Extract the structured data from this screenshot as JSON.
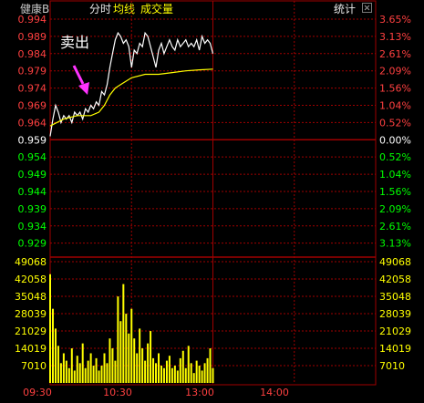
{
  "header": {
    "stock_name": "健康B",
    "tab_fenshi": "分时",
    "tab_junxian": "均线",
    "tab_volume": "成交量",
    "stats_label": "统计"
  },
  "annotation": {
    "text": "卖出",
    "arrow_color": "#ff33ff"
  },
  "colors": {
    "up": "#ff4040",
    "down": "#00ff00",
    "neutral": "#ffffff",
    "grid": "#a00000",
    "price_line": "#ffffff",
    "avg_line": "#ffff00",
    "volume_bar": "#ffff00"
  },
  "chart_data": {
    "type": "line",
    "title": "",
    "price_axis": {
      "ticks": [
        "0.994",
        "0.989",
        "0.984",
        "0.979",
        "0.974",
        "0.969",
        "0.964",
        "0.959",
        "0.954",
        "0.949",
        "0.944",
        "0.939",
        "0.934",
        "0.929"
      ],
      "ylim": [
        0.926,
        0.994
      ],
      "prev_close": 0.959
    },
    "percent_axis": {
      "ticks": [
        "3.65%",
        "3.13%",
        "2.61%",
        "2.09%",
        "1.56%",
        "1.04%",
        "0.52%",
        "0.00%",
        "0.52%",
        "1.04%",
        "1.56%",
        "2.09%",
        "2.61%",
        "3.13%"
      ]
    },
    "volume_axis": {
      "ticks": [
        "49068",
        "42058",
        "35048",
        "28039",
        "21029",
        "14019",
        "7010"
      ],
      "ylim": [
        0,
        49068
      ]
    },
    "x_axis": {
      "ticks": [
        "09:30",
        "10:30",
        "13:00",
        "14:00"
      ],
      "minutes_total": 240
    },
    "series": [
      {
        "name": "分时",
        "x": [
          0,
          2,
          4,
          6,
          8,
          10,
          12,
          14,
          16,
          18,
          20,
          22,
          24,
          26,
          28,
          30,
          32,
          34,
          36,
          38,
          40,
          42,
          44,
          46,
          48,
          50,
          52,
          54,
          56,
          58,
          60,
          62,
          64,
          66,
          68,
          70,
          72,
          74,
          76,
          78,
          80,
          82,
          84,
          86,
          88,
          90,
          92,
          94,
          96,
          98,
          100,
          102,
          104,
          106,
          108,
          110,
          112,
          114,
          116,
          118,
          120
        ],
        "values": [
          0.96,
          0.965,
          0.969,
          0.967,
          0.964,
          0.966,
          0.965,
          0.966,
          0.964,
          0.967,
          0.966,
          0.967,
          0.965,
          0.968,
          0.967,
          0.969,
          0.968,
          0.97,
          0.969,
          0.973,
          0.972,
          0.975,
          0.98,
          0.984,
          0.988,
          0.99,
          0.989,
          0.987,
          0.988,
          0.986,
          0.98,
          0.985,
          0.984,
          0.987,
          0.986,
          0.99,
          0.989,
          0.986,
          0.983,
          0.98,
          0.985,
          0.987,
          0.984,
          0.986,
          0.988,
          0.986,
          0.985,
          0.988,
          0.986,
          0.987,
          0.988,
          0.986,
          0.987,
          0.986,
          0.988,
          0.985,
          0.989,
          0.987,
          0.988,
          0.987,
          0.984
        ]
      },
      {
        "name": "均线",
        "x": [
          0,
          10,
          20,
          30,
          36,
          40,
          44,
          48,
          52,
          56,
          60,
          70,
          80,
          90,
          100,
          110,
          120
        ],
        "values": [
          0.963,
          0.965,
          0.966,
          0.966,
          0.967,
          0.969,
          0.972,
          0.974,
          0.975,
          0.976,
          0.977,
          0.978,
          0.978,
          0.9785,
          0.979,
          0.9793,
          0.9795
        ]
      }
    ],
    "volume": {
      "x": [
        0,
        2,
        4,
        6,
        8,
        10,
        12,
        14,
        16,
        18,
        20,
        22,
        24,
        26,
        28,
        30,
        32,
        34,
        36,
        38,
        40,
        42,
        44,
        46,
        48,
        50,
        52,
        54,
        56,
        58,
        60,
        62,
        64,
        66,
        68,
        70,
        72,
        74,
        76,
        78,
        80,
        82,
        84,
        86,
        88,
        90,
        92,
        94,
        96,
        98,
        100,
        102,
        104,
        106,
        108,
        110,
        112,
        114,
        116,
        118,
        120
      ],
      "values": [
        44000,
        30000,
        22000,
        15000,
        8000,
        12000,
        9000,
        6000,
        14000,
        5000,
        11000,
        8000,
        16000,
        6000,
        9000,
        12000,
        7000,
        10000,
        5000,
        7000,
        12000,
        8000,
        18000,
        14000,
        9000,
        35000,
        25000,
        40000,
        28000,
        20000,
        30000,
        18000,
        12000,
        22000,
        14000,
        9000,
        16000,
        21000,
        10000,
        8000,
        12000,
        7000,
        6000,
        9000,
        11000,
        6000,
        7000,
        5000,
        10000,
        13000,
        6000,
        15000,
        8000,
        4000,
        9000,
        7000,
        5000,
        8000,
        10000,
        14000,
        6000
      ]
    }
  }
}
